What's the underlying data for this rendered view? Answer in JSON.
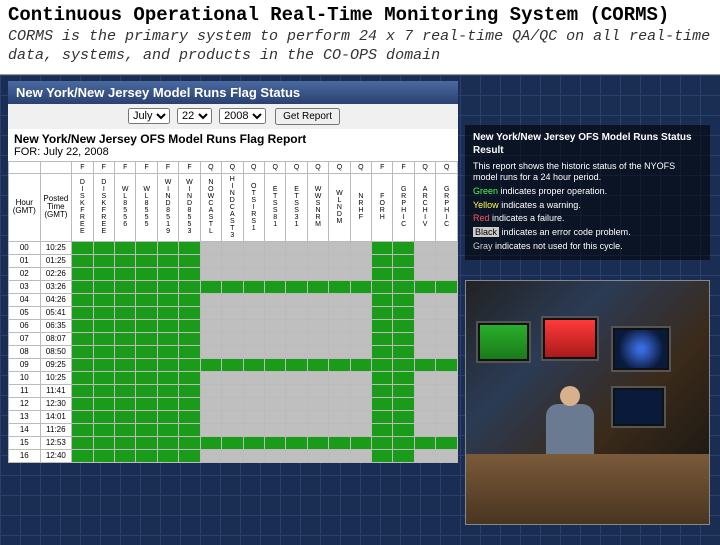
{
  "header": {
    "title": "Continuous Operational Real-Time Monitoring System (CORMS)",
    "subtitle": "CORMS is the primary system to perform 24 x 7 real-time QA/QC on all real-time data, systems, and products in the CO-OPS domain"
  },
  "top_bar": {
    "title": "New York/New Jersey Model Runs Flag Status",
    "month": "July",
    "day": "22",
    "year": "2008",
    "button": "Get Report"
  },
  "report": {
    "title": "New York/New Jersey OFS Model Runs Flag Report",
    "for_label": "FOR: July 22, 2008",
    "row_header1": "Hour (GMT)",
    "row_header2": "Posted Time (GMT)",
    "group_headers": [
      "F",
      "F",
      "F",
      "F",
      "F",
      "F",
      "Q",
      "Q",
      "Q",
      "Q",
      "Q",
      "Q",
      "Q",
      "Q",
      "F",
      "F",
      "Q",
      "Q"
    ],
    "col_headers": [
      "DISK FREE",
      "DISK FREE",
      "WL 8556",
      "WL 8555",
      "WIND 8519",
      "WIND 8553",
      "NOWCASTL",
      "HINDCAST 3",
      "OTS IRS 1",
      "ETSS 81",
      "ETSS 31",
      "WWS NRM",
      "WL NDM",
      "NRHF",
      "FORH",
      "GRPHIC",
      "ARCHIV",
      "GRPHIC"
    ],
    "rows": [
      {
        "hr": "00",
        "time": "10:25",
        "cells": [
          "g",
          "g",
          "g",
          "g",
          "g",
          "g",
          "x",
          "x",
          "x",
          "x",
          "x",
          "x",
          "x",
          "x",
          "g",
          "g",
          "x",
          "x"
        ]
      },
      {
        "hr": "01",
        "time": "01:25",
        "cells": [
          "g",
          "g",
          "g",
          "g",
          "g",
          "g",
          "x",
          "x",
          "x",
          "x",
          "x",
          "x",
          "x",
          "x",
          "g",
          "g",
          "x",
          "x"
        ]
      },
      {
        "hr": "02",
        "time": "02:26",
        "cells": [
          "g",
          "g",
          "g",
          "g",
          "g",
          "g",
          "x",
          "x",
          "x",
          "x",
          "x",
          "x",
          "x",
          "x",
          "g",
          "g",
          "x",
          "x"
        ]
      },
      {
        "hr": "03",
        "time": "03:26",
        "cells": [
          "g",
          "g",
          "g",
          "g",
          "g",
          "g",
          "g",
          "g",
          "g",
          "g",
          "g",
          "g",
          "g",
          "g",
          "g",
          "g",
          "g",
          "g"
        ]
      },
      {
        "hr": "04",
        "time": "04:26",
        "cells": [
          "g",
          "g",
          "g",
          "g",
          "g",
          "g",
          "x",
          "x",
          "x",
          "x",
          "x",
          "x",
          "x",
          "x",
          "g",
          "g",
          "x",
          "x"
        ]
      },
      {
        "hr": "05",
        "time": "05:41",
        "cells": [
          "g",
          "g",
          "g",
          "g",
          "g",
          "g",
          "x",
          "x",
          "x",
          "x",
          "x",
          "x",
          "x",
          "x",
          "g",
          "g",
          "x",
          "x"
        ]
      },
      {
        "hr": "06",
        "time": "06:35",
        "cells": [
          "g",
          "g",
          "g",
          "g",
          "g",
          "g",
          "x",
          "x",
          "x",
          "x",
          "x",
          "x",
          "x",
          "x",
          "g",
          "g",
          "x",
          "x"
        ]
      },
      {
        "hr": "07",
        "time": "08:07",
        "cells": [
          "g",
          "g",
          "g",
          "g",
          "g",
          "g",
          "x",
          "x",
          "x",
          "x",
          "x",
          "x",
          "x",
          "x",
          "g",
          "g",
          "x",
          "x"
        ]
      },
      {
        "hr": "08",
        "time": "08:50",
        "cells": [
          "g",
          "g",
          "g",
          "g",
          "g",
          "g",
          "x",
          "x",
          "x",
          "x",
          "x",
          "x",
          "x",
          "x",
          "g",
          "g",
          "x",
          "x"
        ]
      },
      {
        "hr": "09",
        "time": "09:25",
        "cells": [
          "g",
          "g",
          "g",
          "g",
          "g",
          "g",
          "g",
          "g",
          "g",
          "g",
          "g",
          "g",
          "g",
          "g",
          "g",
          "g",
          "g",
          "g"
        ]
      },
      {
        "hr": "10",
        "time": "10:25",
        "cells": [
          "g",
          "g",
          "g",
          "g",
          "g",
          "g",
          "x",
          "x",
          "x",
          "x",
          "x",
          "x",
          "x",
          "x",
          "g",
          "g",
          "x",
          "x"
        ]
      },
      {
        "hr": "11",
        "time": "11:41",
        "cells": [
          "g",
          "g",
          "g",
          "g",
          "g",
          "g",
          "x",
          "x",
          "x",
          "x",
          "x",
          "x",
          "x",
          "x",
          "g",
          "g",
          "x",
          "x"
        ]
      },
      {
        "hr": "12",
        "time": "12:30",
        "cells": [
          "g",
          "g",
          "g",
          "g",
          "g",
          "g",
          "x",
          "x",
          "x",
          "x",
          "x",
          "x",
          "x",
          "x",
          "g",
          "g",
          "x",
          "x"
        ]
      },
      {
        "hr": "13",
        "time": "14:01",
        "cells": [
          "g",
          "g",
          "g",
          "g",
          "g",
          "g",
          "x",
          "x",
          "x",
          "x",
          "x",
          "x",
          "x",
          "x",
          "g",
          "g",
          "x",
          "x"
        ]
      },
      {
        "hr": "14",
        "time": "11:26",
        "cells": [
          "g",
          "g",
          "g",
          "g",
          "g",
          "g",
          "x",
          "x",
          "x",
          "x",
          "x",
          "x",
          "x",
          "x",
          "g",
          "g",
          "x",
          "x"
        ]
      },
      {
        "hr": "15",
        "time": "12:53",
        "cells": [
          "g",
          "g",
          "g",
          "g",
          "g",
          "g",
          "g",
          "g",
          "g",
          "g",
          "g",
          "g",
          "g",
          "g",
          "g",
          "g",
          "g",
          "g"
        ]
      },
      {
        "hr": "16",
        "time": "12:40",
        "cells": [
          "g",
          "g",
          "g",
          "g",
          "g",
          "g",
          "x",
          "x",
          "x",
          "x",
          "x",
          "x",
          "x",
          "x",
          "g",
          "g",
          "x",
          "x"
        ]
      }
    ]
  },
  "status": {
    "title": "New York/New Jersey OFS Model Runs Status Result",
    "intro": "This report shows the historic status of the NYOFS model runs for a 24 hour period.",
    "lines": [
      {
        "color": "c-green",
        "label": "Green",
        "text": " indicates proper operation."
      },
      {
        "color": "c-yellow",
        "label": "Yellow",
        "text": " indicates a warning."
      },
      {
        "color": "c-red",
        "label": "Red",
        "text": " indicates a failure."
      },
      {
        "color": "c-black",
        "label": "Black",
        "text": " indicates an error code problem."
      },
      {
        "color": "c-gray",
        "label": "Gray",
        "text": " indicates not used for this cycle."
      }
    ]
  }
}
